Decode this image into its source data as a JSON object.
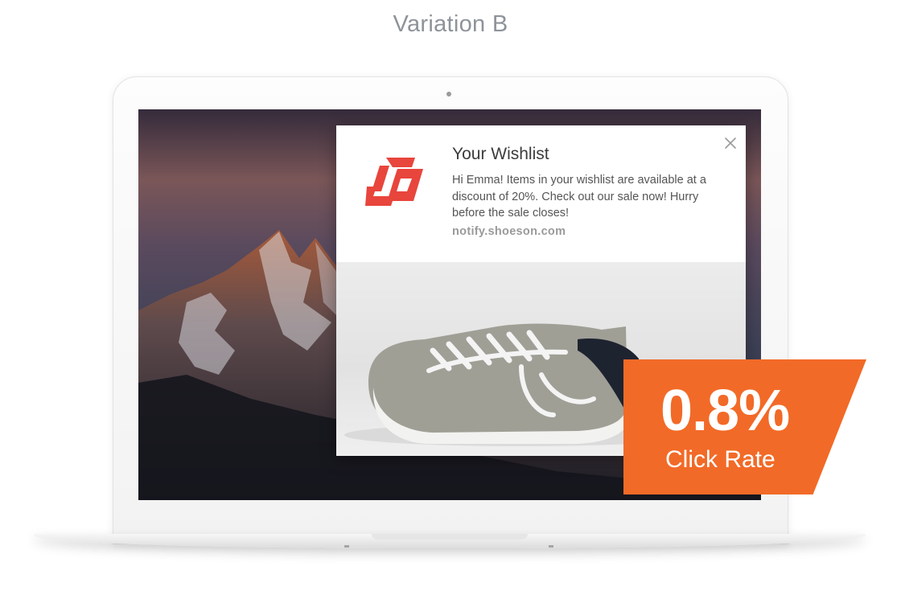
{
  "header": {
    "title": "Variation B"
  },
  "notification": {
    "title": "Your Wishlist",
    "body": "Hi Emma! Items in your wishlist are available at a discount of 20%. Check out our sale now! Hurry before the sale closes!",
    "domain": "notify.shoeson.com",
    "logo_icon": "brand-logo-icon",
    "close_icon": "close-icon",
    "image": "sneaker-image",
    "brand_color": "#e8453c"
  },
  "badge": {
    "value": "0.8%",
    "label": "Click Rate",
    "color": "#f26a27"
  }
}
